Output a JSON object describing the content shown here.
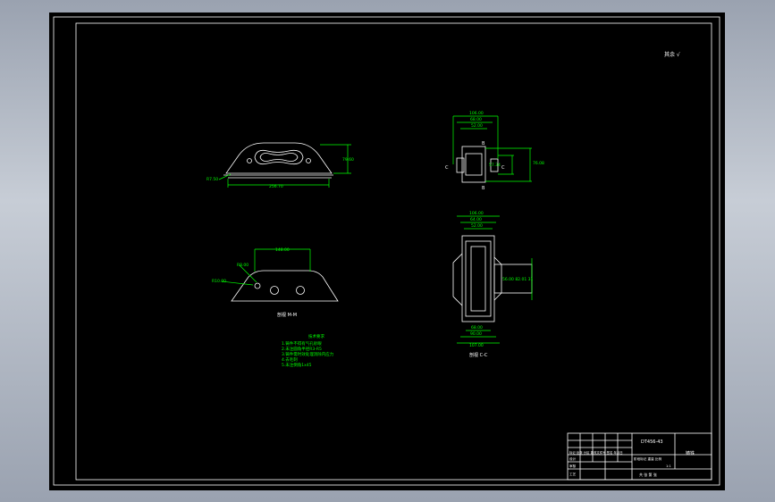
{
  "sheet": {
    "roughness": "其余 √",
    "drawing_no": "DT456-43",
    "material_cell": "铸铁",
    "section_a": "剖视 M-M",
    "section_c": "剖视 C-C",
    "tech_title": "技术要求"
  },
  "tech_notes": [
    "1.铸件不得有气孔砂眼",
    "2.未注圆角半径R3-R5",
    "3.铸件需时效处理消除内应力",
    "4.去毛刺",
    "5.未注倒角1x45"
  ],
  "dimensions": {
    "top_left": {
      "r": "R7.50",
      "height": "79.60",
      "width": "256.70"
    },
    "bottom_left": {
      "span": "148.00",
      "d1": "R8.00",
      "d2": "R10.00"
    },
    "top_right": {
      "w1": "106.00",
      "w2": "68.00",
      "w3": "52.00",
      "h1": "57.34",
      "h2": "76.08",
      "sec_b": "B",
      "sec_c": "C"
    },
    "bottom_right": {
      "w1": "106.00",
      "w2": "64.00",
      "w3": "52.00",
      "b1": "68.00",
      "b2": "90.00",
      "b3": "107.00",
      "h": "56.00 82.01 31"
    }
  },
  "title_block": {
    "rows": [
      "标记 处数 分区 更改文件号 签名 年月日",
      "设计",
      "审核",
      "工艺"
    ],
    "stage": "阶段标记 重量 比例",
    "scale": "1:1",
    "sheet_info": "共 张 第 张"
  }
}
